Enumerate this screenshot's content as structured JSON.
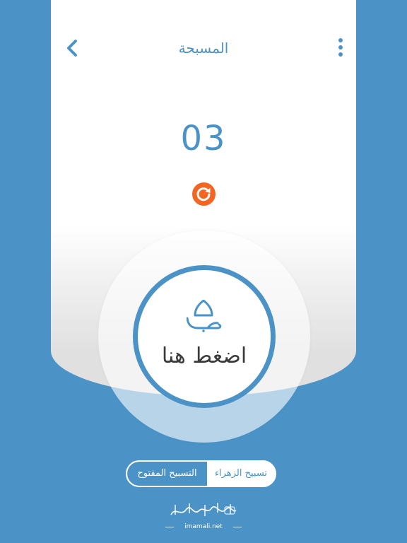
{
  "header": {
    "title": "المسبحة",
    "back_icon": "chevron-left-icon",
    "menu_icon": "more-vertical-icon"
  },
  "counter": {
    "value": "03"
  },
  "reset": {
    "icon": "refresh-icon",
    "color": "#f26522"
  },
  "tap_button": {
    "label": "اضغط هنا",
    "icon": "shrine-dome-icon"
  },
  "mode_toggle": {
    "options": [
      {
        "label": "التسبيح المفتوح",
        "selected": true
      },
      {
        "label": "تسبيح الزهراء",
        "selected": false
      }
    ]
  },
  "brand": {
    "logo_text": "شبكة الإمام علي",
    "url": "imamali.net"
  },
  "colors": {
    "accent": "#4b93c7",
    "background": "#4b93c7",
    "reset": "#f26522",
    "card": "#ffffff"
  }
}
